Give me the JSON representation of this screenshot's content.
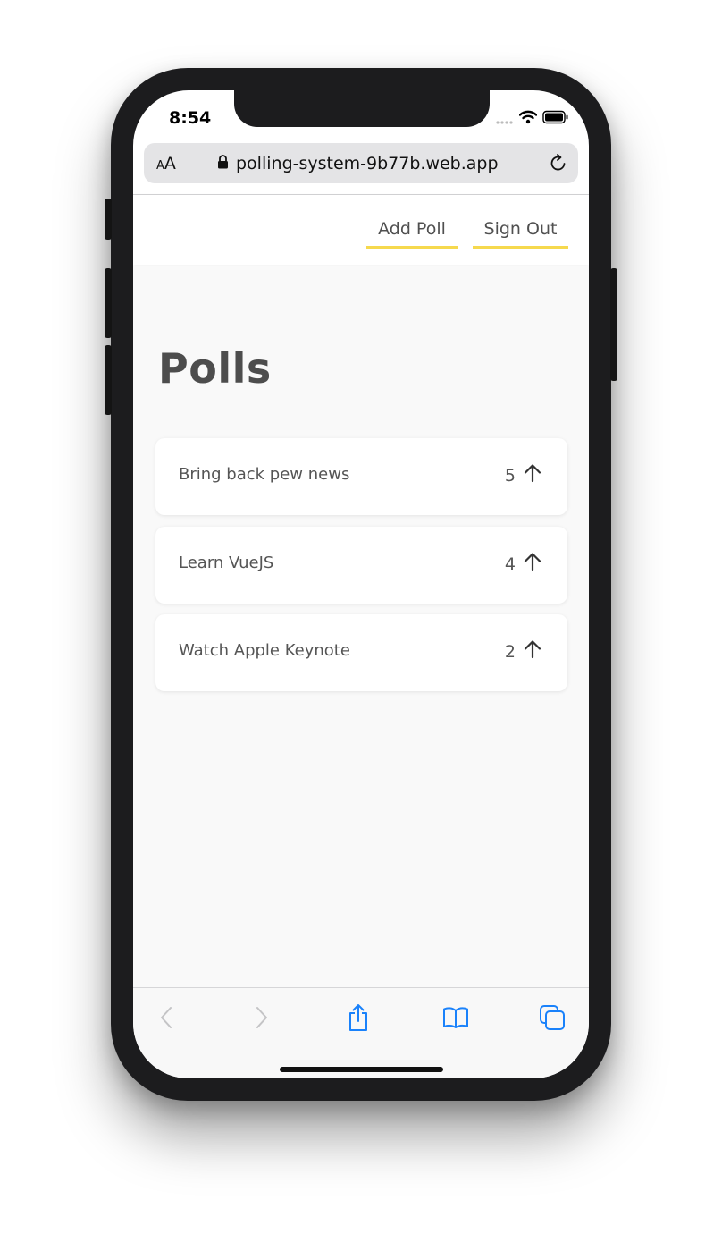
{
  "status": {
    "time": "8:54"
  },
  "browser": {
    "text_size_small": "A",
    "text_size_large": "A",
    "url": "polling-system-9b77b.web.app"
  },
  "nav": {
    "add_poll": "Add Poll",
    "sign_out": "Sign Out"
  },
  "page": {
    "title": "Polls"
  },
  "polls": [
    {
      "question": "Bring back pew news",
      "votes": "5"
    },
    {
      "question": "Learn VueJS",
      "votes": "4"
    },
    {
      "question": "Watch Apple Keynote",
      "votes": "2"
    }
  ],
  "colors": {
    "accent_underline": "#f6d94e",
    "safari_blue": "#1a82fb",
    "content_bg": "#f9f9f9"
  },
  "icons": [
    "lock-icon",
    "reload-icon",
    "wifi-icon",
    "battery-icon",
    "arrow-up-icon",
    "back-icon",
    "forward-icon",
    "share-icon",
    "bookmarks-icon",
    "tabs-icon"
  ]
}
